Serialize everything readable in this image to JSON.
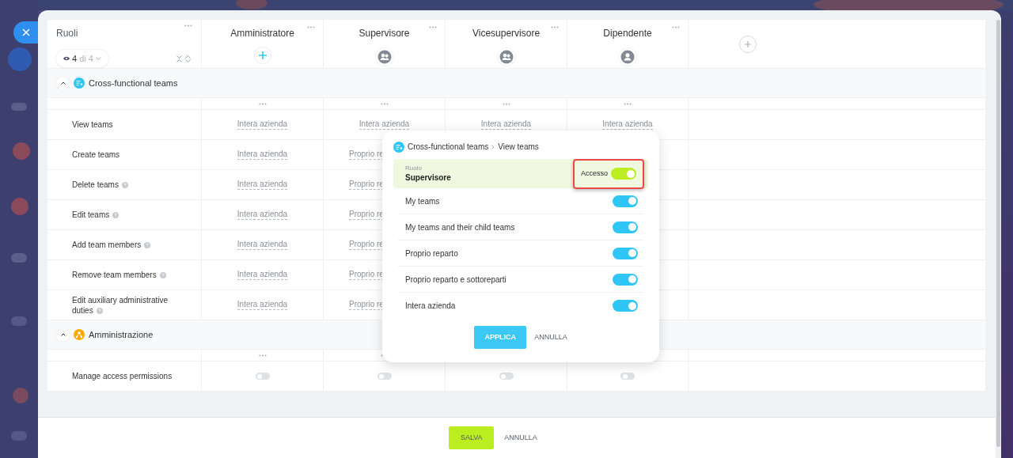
{
  "roles_header": {
    "title": "Ruoli",
    "visible_count": "4",
    "total": "di 4"
  },
  "columns": [
    {
      "title": "Amministratore",
      "kind": "add"
    },
    {
      "title": "Supervisore",
      "kind": "group"
    },
    {
      "title": "Vicesupervisore",
      "kind": "group"
    },
    {
      "title": "Dipendente",
      "kind": "person"
    }
  ],
  "sections": [
    {
      "title": "Cross-functional teams",
      "kind": "teams",
      "expanded": true,
      "rows": [
        {
          "label": "View teams",
          "help": false,
          "cells": [
            {
              "kind": "text",
              "text": "Intera azienda",
              "clipped": false
            },
            {
              "kind": "text",
              "text": "Intera azienda",
              "clipped": false
            },
            {
              "kind": "text",
              "text": "Intera azienda",
              "clipped": false
            },
            {
              "kind": "text",
              "text": "Intera azienda",
              "clipped": false
            }
          ]
        },
        {
          "label": "Create teams",
          "help": false,
          "cells": [
            {
              "kind": "text",
              "text": "Intera azienda",
              "clipped": false
            },
            {
              "kind": "text",
              "text": "Proprio re",
              "clipped": true
            }
          ]
        },
        {
          "label": "Delete teams",
          "help": true,
          "cells": [
            {
              "kind": "text",
              "text": "Intera azienda",
              "clipped": false
            },
            {
              "kind": "text",
              "text": "Proprio re",
              "clipped": true
            }
          ]
        },
        {
          "label": "Edit teams",
          "help": true,
          "cells": [
            {
              "kind": "text",
              "text": "Intera azienda",
              "clipped": false
            },
            {
              "kind": "text",
              "text": "Proprio re",
              "clipped": true
            }
          ]
        },
        {
          "label": "Add team members",
          "help": true,
          "cells": [
            {
              "kind": "text",
              "text": "Intera azienda",
              "clipped": false
            },
            {
              "kind": "text",
              "text": "Proprio re",
              "clipped": true
            }
          ]
        },
        {
          "label": "Remove team members",
          "help": true,
          "cells": [
            {
              "kind": "text",
              "text": "Intera azienda",
              "clipped": false
            },
            {
              "kind": "text",
              "text": "Proprio re",
              "clipped": true
            }
          ]
        },
        {
          "label": "Edit auxiliary administrative duties",
          "help": true,
          "cells": [
            {
              "kind": "text",
              "text": "Intera azienda",
              "clipped": false
            },
            {
              "kind": "text",
              "text": "Proprio re",
              "clipped": true
            }
          ]
        }
      ]
    },
    {
      "title": "Amministrazione",
      "kind": "admin",
      "expanded": true,
      "rows": [
        {
          "label": "Manage access permissions",
          "help": false,
          "cells": [
            {
              "kind": "switch",
              "on": false
            },
            {
              "kind": "switch",
              "on": false
            },
            {
              "kind": "switch",
              "on": false
            },
            {
              "kind": "switch",
              "on": false
            }
          ]
        }
      ]
    }
  ],
  "popup": {
    "breadcrumb": [
      "Cross-functional teams",
      "View teams"
    ],
    "role_label": "Ruolo",
    "role": "Supervisore",
    "access_label": "Accesso",
    "access_on": true,
    "highlighted": true,
    "options": [
      {
        "label": "My teams",
        "on": true
      },
      {
        "label": "My teams and their child teams",
        "on": true
      },
      {
        "label": "Proprio reparto",
        "on": true
      },
      {
        "label": "Proprio reparto e sottoreparti",
        "on": true
      },
      {
        "label": "Intera azienda",
        "on": true
      }
    ],
    "apply": "APPLICA",
    "cancel": "ANNULLA"
  },
  "footer": {
    "save": "SALVA",
    "cancel": "ANNULLA"
  }
}
